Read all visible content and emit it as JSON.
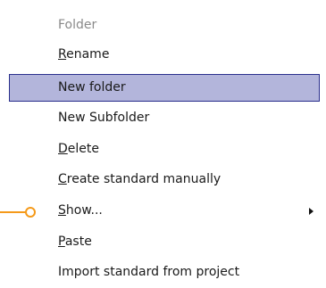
{
  "colors": {
    "highlight_fill": "#b3b5db",
    "highlight_border": "#2a2f8c",
    "disabled_text": "#8a8a8a",
    "connector": "#f59a1a"
  },
  "menu": {
    "items": [
      {
        "label": "Folder",
        "state": "disabled"
      },
      {
        "label": "Rename",
        "mnemonic": "R"
      },
      {
        "label": "New folder",
        "state": "highlighted"
      },
      {
        "label": "New Subfolder"
      },
      {
        "label": "Delete",
        "mnemonic": "D"
      },
      {
        "label": "Create standard manually",
        "mnemonic": "C"
      },
      {
        "label": "Show...",
        "mnemonic": "S",
        "submenu_icon": "chevron-right-icon"
      },
      {
        "label": "Paste",
        "mnemonic": "P"
      },
      {
        "label": "Import standard from project"
      }
    ]
  }
}
